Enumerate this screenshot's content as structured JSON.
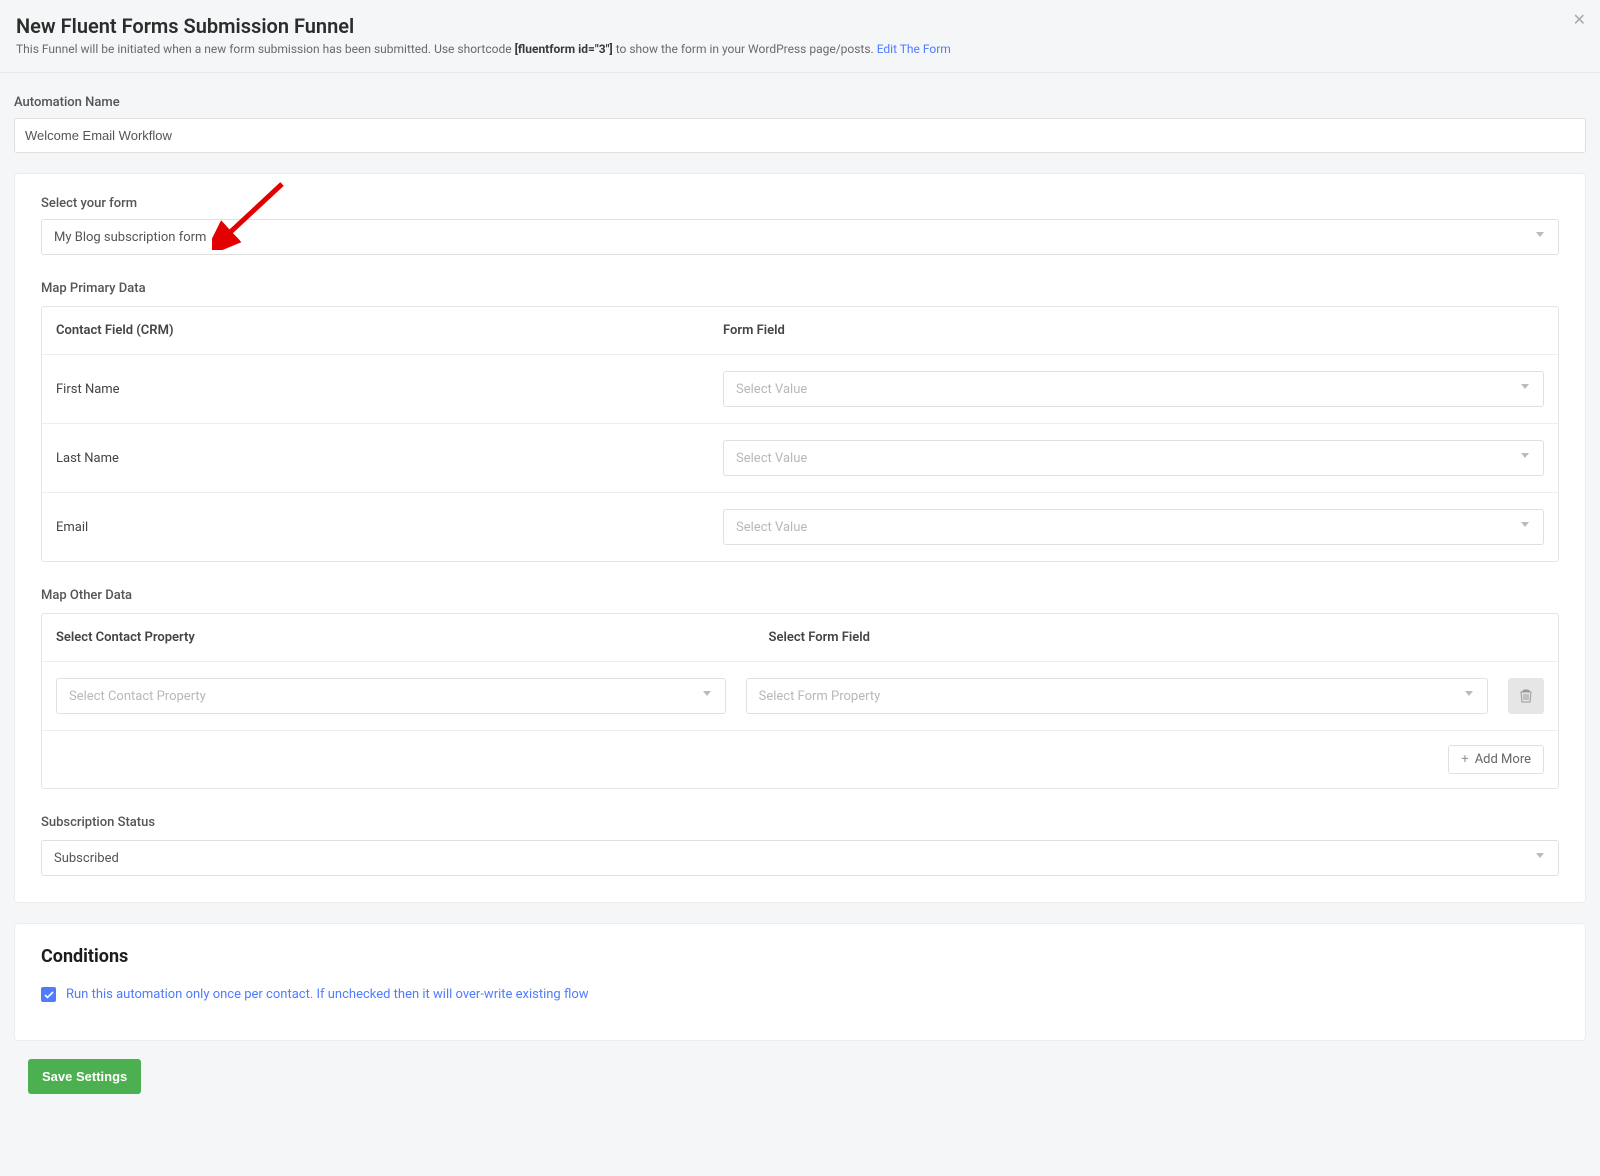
{
  "header": {
    "title": "New Fluent Forms Submission Funnel",
    "desc_a": "This Funnel will be initiated when a new form submission has been submitted. Use shortcode ",
    "desc_code": "[fluentform id=\"3\"]",
    "desc_b": " to show the form in your WordPress page/posts. ",
    "edit_link": "Edit The Form"
  },
  "automation_name": {
    "label": "Automation Name",
    "value": "Welcome Email Workflow"
  },
  "form_select": {
    "label": "Select your form",
    "value": "My Blog subscription form"
  },
  "map_primary": {
    "title": "Map Primary Data",
    "col_a": "Contact Field (CRM)",
    "col_b": "Form Field",
    "rows": [
      {
        "label": "First Name",
        "placeholder": "Select Value"
      },
      {
        "label": "Last Name",
        "placeholder": "Select Value"
      },
      {
        "label": "Email",
        "placeholder": "Select Value"
      }
    ]
  },
  "map_other": {
    "title": "Map Other Data",
    "col_a": "Select Contact Property",
    "col_b": "Select Form Field",
    "placeholder_a": "Select Contact Property",
    "placeholder_b": "Select Form Property",
    "add_more": "Add More"
  },
  "subscription": {
    "label": "Subscription Status",
    "value": "Subscribed"
  },
  "conditions": {
    "title": "Conditions",
    "checkbox_label": "Run this automation only once per contact. If unchecked then it will over-write existing flow"
  },
  "save_button": "Save Settings"
}
